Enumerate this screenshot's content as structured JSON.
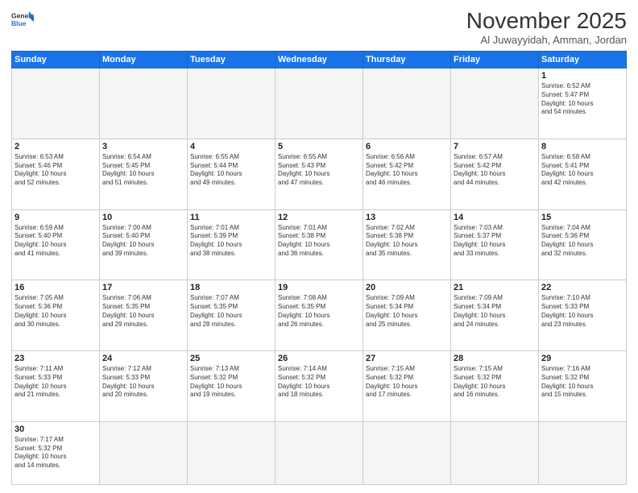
{
  "header": {
    "logo_general": "General",
    "logo_blue": "Blue",
    "month_title": "November 2025",
    "subtitle": "Al Juwayyidah, Amman, Jordan"
  },
  "weekdays": [
    "Sunday",
    "Monday",
    "Tuesday",
    "Wednesday",
    "Thursday",
    "Friday",
    "Saturday"
  ],
  "weeks": [
    [
      {
        "day": "",
        "info": ""
      },
      {
        "day": "",
        "info": ""
      },
      {
        "day": "",
        "info": ""
      },
      {
        "day": "",
        "info": ""
      },
      {
        "day": "",
        "info": ""
      },
      {
        "day": "",
        "info": ""
      },
      {
        "day": "1",
        "info": "Sunrise: 6:52 AM\nSunset: 5:47 PM\nDaylight: 10 hours\nand 54 minutes."
      }
    ],
    [
      {
        "day": "2",
        "info": "Sunrise: 6:53 AM\nSunset: 5:46 PM\nDaylight: 10 hours\nand 52 minutes."
      },
      {
        "day": "3",
        "info": "Sunrise: 6:54 AM\nSunset: 5:45 PM\nDaylight: 10 hours\nand 51 minutes."
      },
      {
        "day": "4",
        "info": "Sunrise: 6:55 AM\nSunset: 5:44 PM\nDaylight: 10 hours\nand 49 minutes."
      },
      {
        "day": "5",
        "info": "Sunrise: 6:55 AM\nSunset: 5:43 PM\nDaylight: 10 hours\nand 47 minutes."
      },
      {
        "day": "6",
        "info": "Sunrise: 6:56 AM\nSunset: 5:42 PM\nDaylight: 10 hours\nand 46 minutes."
      },
      {
        "day": "7",
        "info": "Sunrise: 6:57 AM\nSunset: 5:42 PM\nDaylight: 10 hours\nand 44 minutes."
      },
      {
        "day": "8",
        "info": "Sunrise: 6:58 AM\nSunset: 5:41 PM\nDaylight: 10 hours\nand 42 minutes."
      }
    ],
    [
      {
        "day": "9",
        "info": "Sunrise: 6:59 AM\nSunset: 5:40 PM\nDaylight: 10 hours\nand 41 minutes."
      },
      {
        "day": "10",
        "info": "Sunrise: 7:00 AM\nSunset: 5:40 PM\nDaylight: 10 hours\nand 39 minutes."
      },
      {
        "day": "11",
        "info": "Sunrise: 7:01 AM\nSunset: 5:39 PM\nDaylight: 10 hours\nand 38 minutes."
      },
      {
        "day": "12",
        "info": "Sunrise: 7:01 AM\nSunset: 5:38 PM\nDaylight: 10 hours\nand 36 minutes."
      },
      {
        "day": "13",
        "info": "Sunrise: 7:02 AM\nSunset: 5:38 PM\nDaylight: 10 hours\nand 35 minutes."
      },
      {
        "day": "14",
        "info": "Sunrise: 7:03 AM\nSunset: 5:37 PM\nDaylight: 10 hours\nand 33 minutes."
      },
      {
        "day": "15",
        "info": "Sunrise: 7:04 AM\nSunset: 5:36 PM\nDaylight: 10 hours\nand 32 minutes."
      }
    ],
    [
      {
        "day": "16",
        "info": "Sunrise: 7:05 AM\nSunset: 5:36 PM\nDaylight: 10 hours\nand 30 minutes."
      },
      {
        "day": "17",
        "info": "Sunrise: 7:06 AM\nSunset: 5:35 PM\nDaylight: 10 hours\nand 29 minutes."
      },
      {
        "day": "18",
        "info": "Sunrise: 7:07 AM\nSunset: 5:35 PM\nDaylight: 10 hours\nand 28 minutes."
      },
      {
        "day": "19",
        "info": "Sunrise: 7:08 AM\nSunset: 5:35 PM\nDaylight: 10 hours\nand 26 minutes."
      },
      {
        "day": "20",
        "info": "Sunrise: 7:09 AM\nSunset: 5:34 PM\nDaylight: 10 hours\nand 25 minutes."
      },
      {
        "day": "21",
        "info": "Sunrise: 7:09 AM\nSunset: 5:34 PM\nDaylight: 10 hours\nand 24 minutes."
      },
      {
        "day": "22",
        "info": "Sunrise: 7:10 AM\nSunset: 5:33 PM\nDaylight: 10 hours\nand 23 minutes."
      }
    ],
    [
      {
        "day": "23",
        "info": "Sunrise: 7:11 AM\nSunset: 5:33 PM\nDaylight: 10 hours\nand 21 minutes."
      },
      {
        "day": "24",
        "info": "Sunrise: 7:12 AM\nSunset: 5:33 PM\nDaylight: 10 hours\nand 20 minutes."
      },
      {
        "day": "25",
        "info": "Sunrise: 7:13 AM\nSunset: 5:32 PM\nDaylight: 10 hours\nand 19 minutes."
      },
      {
        "day": "26",
        "info": "Sunrise: 7:14 AM\nSunset: 5:32 PM\nDaylight: 10 hours\nand 18 minutes."
      },
      {
        "day": "27",
        "info": "Sunrise: 7:15 AM\nSunset: 5:32 PM\nDaylight: 10 hours\nand 17 minutes."
      },
      {
        "day": "28",
        "info": "Sunrise: 7:15 AM\nSunset: 5:32 PM\nDaylight: 10 hours\nand 16 minutes."
      },
      {
        "day": "29",
        "info": "Sunrise: 7:16 AM\nSunset: 5:32 PM\nDaylight: 10 hours\nand 15 minutes."
      }
    ],
    [
      {
        "day": "30",
        "info": "Sunrise: 7:17 AM\nSunset: 5:32 PM\nDaylight: 10 hours\nand 14 minutes."
      },
      {
        "day": "",
        "info": ""
      },
      {
        "day": "",
        "info": ""
      },
      {
        "day": "",
        "info": ""
      },
      {
        "day": "",
        "info": ""
      },
      {
        "day": "",
        "info": ""
      },
      {
        "day": "",
        "info": ""
      }
    ]
  ]
}
